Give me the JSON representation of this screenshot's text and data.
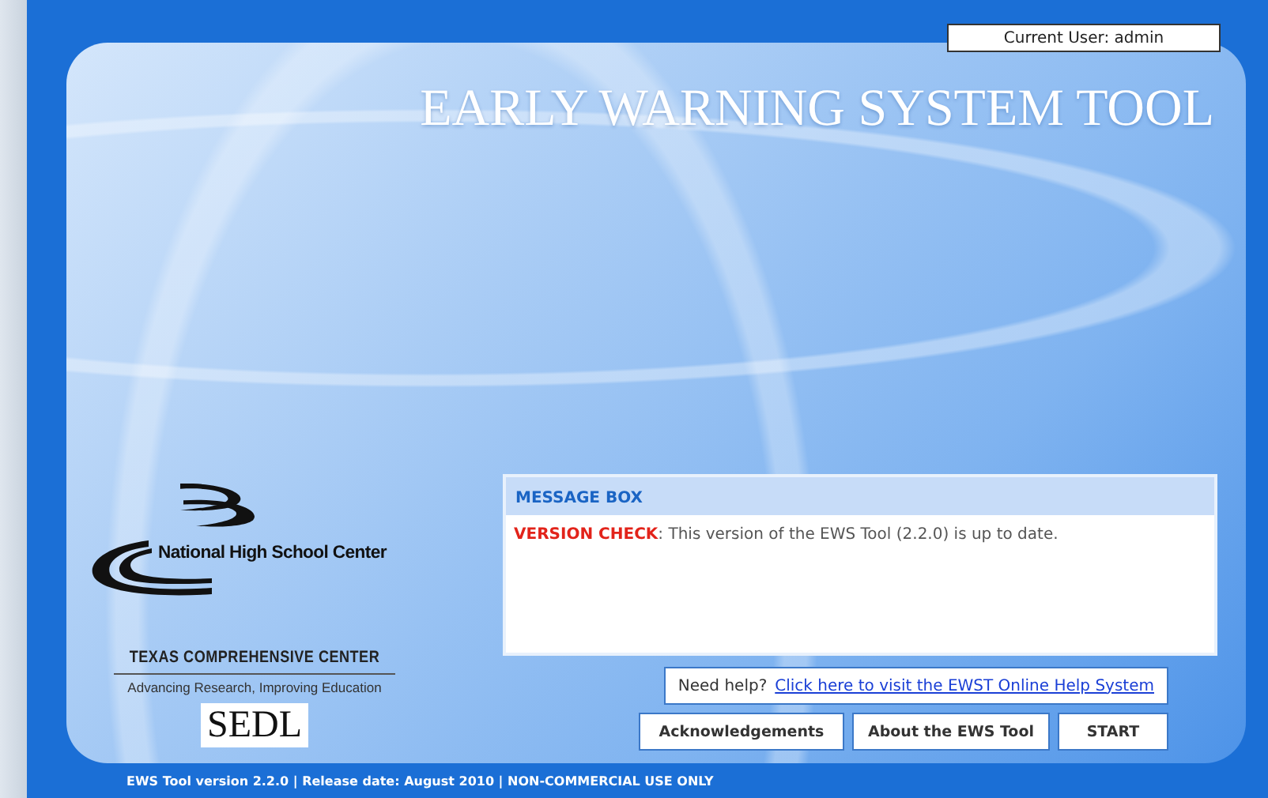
{
  "current_user": "Current User: admin",
  "title": "EARLY WARNING SYSTEM TOOL",
  "logos": {
    "nhsc": "National High School Center",
    "texas": "TEXAS COMPREHENSIVE CENTER",
    "texas_tagline": "Advancing Research, Improving Education",
    "sedl": "SEDL"
  },
  "message_box": {
    "heading": "MESSAGE BOX",
    "messages": [
      "**VERSION CHECK**: This version of the EWS Tool (2.2.0) is up to date."
    ]
  },
  "help": {
    "label": "Need help?",
    "link": "Click here to visit the EWST Online Help System"
  },
  "buttons": [
    "Acknowledgements",
    "About the EWS Tool",
    "START"
  ],
  "footer": "EWS Tool version 2.2.0 | Release date: August 2010 | NON-COMMERCIAL USE ONLY"
}
